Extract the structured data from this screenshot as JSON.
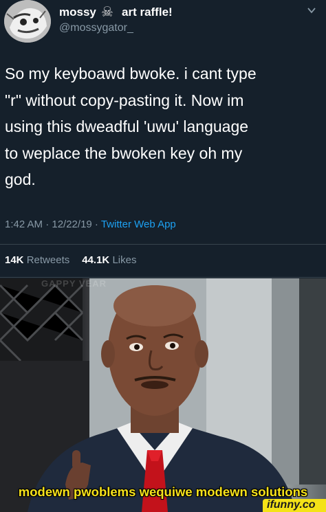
{
  "tweet": {
    "display_name": "mossy",
    "name_icon": "skull-crossbones-icon",
    "name_suffix": "art raffle!",
    "handle": "@mossygator_",
    "text": "So my keyboawd bwoke. i cant type\n\"r\" without copy-pasting it. Now im\nusing this dweadful 'uwu' language\nto weplace the bwoken key oh my\ngod.",
    "time": "1:42 AM · 12/22/19 · ",
    "source": "Twitter Web App",
    "retweets_count": "14K",
    "retweets_label": "Retweets",
    "likes_count": "44.1K",
    "likes_label": "Likes"
  },
  "meme": {
    "faint_text": "GAPPY VEAR",
    "caption": "modewn pwoblems wequiwe modewn solutions",
    "watermark": "ifunny.co"
  },
  "colors": {
    "background": "#15202b",
    "secondary_text": "#8899a6",
    "link": "#1da1f2",
    "caption": "#f6e21b",
    "watermark_bg": "#f4e217"
  }
}
